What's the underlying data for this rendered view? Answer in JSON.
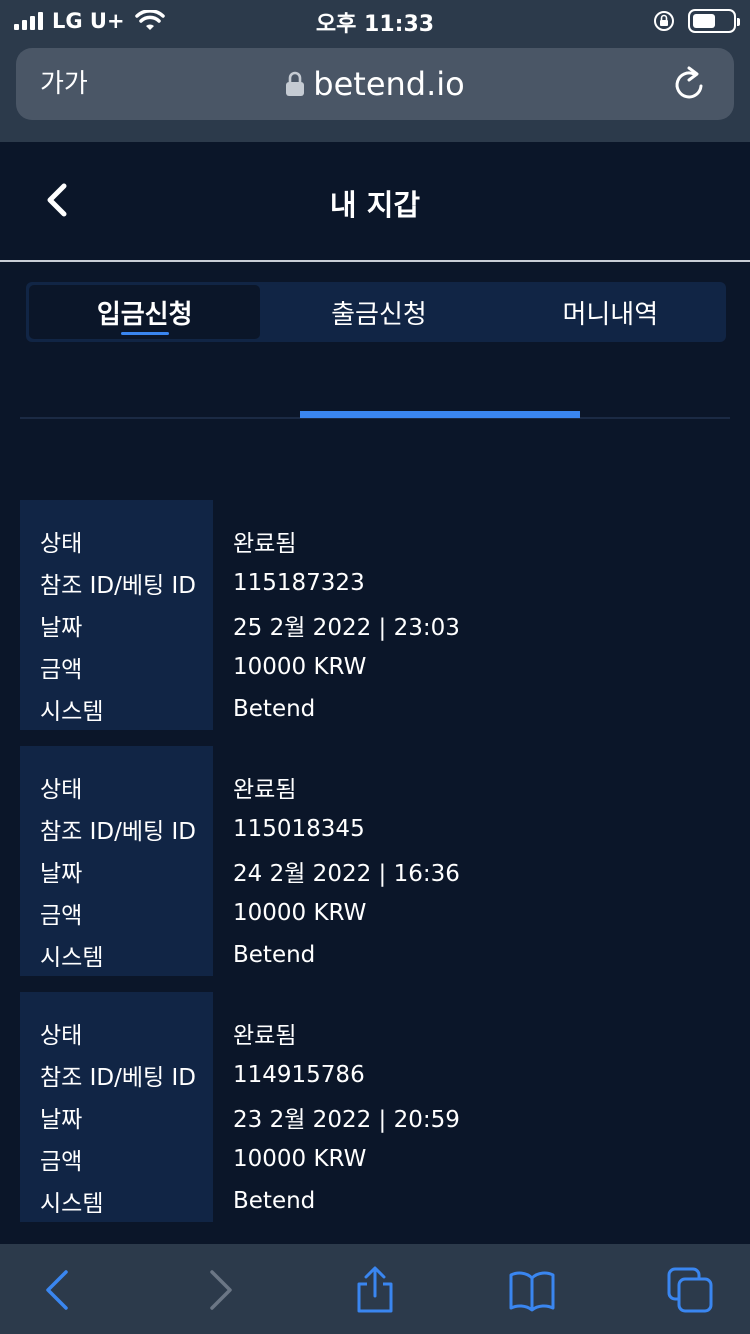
{
  "status_bar": {
    "carrier": "LG U+",
    "time": "오후 11:33"
  },
  "browser": {
    "text_size_label": "가가",
    "url": "betend.io"
  },
  "header": {
    "title": "내 지갑"
  },
  "tabs": [
    {
      "label": "입금신청",
      "active": true
    },
    {
      "label": "출금신청",
      "active": false
    },
    {
      "label": "머니내역",
      "active": false
    }
  ],
  "records": [
    {
      "rows": [
        {
          "label": "상태",
          "value": "완료됨"
        },
        {
          "label": "참조 ID/베팅 ID",
          "value": "115187323"
        },
        {
          "label": "날짜",
          "value": "25 2월 2022 | 23:03"
        },
        {
          "label": "금액",
          "value": "10000 KRW"
        },
        {
          "label": "시스템",
          "value": "Betend"
        }
      ]
    },
    {
      "rows": [
        {
          "label": "상태",
          "value": "완료됨"
        },
        {
          "label": "참조 ID/베팅 ID",
          "value": "115018345"
        },
        {
          "label": "날짜",
          "value": "24 2월 2022 | 16:36"
        },
        {
          "label": "금액",
          "value": "10000 KRW"
        },
        {
          "label": "시스템",
          "value": "Betend"
        }
      ]
    },
    {
      "rows": [
        {
          "label": "상태",
          "value": "완료됨"
        },
        {
          "label": "참조 ID/베팅 ID",
          "value": "114915786"
        },
        {
          "label": "날짜",
          "value": "23 2월 2022 | 20:59"
        },
        {
          "label": "금액",
          "value": "10000 KRW"
        },
        {
          "label": "시스템",
          "value": "Betend"
        }
      ]
    }
  ],
  "colors": {
    "background": "#0b1629",
    "panel": "#112545",
    "accent": "#3a86f0",
    "browser_chrome": "#2c3a4b"
  },
  "icons": {
    "back": "chevron-left-icon",
    "reload": "reload-icon",
    "lock": "lock-icon",
    "share": "share-icon",
    "bookmarks": "book-icon",
    "tabs": "tabs-icon"
  }
}
